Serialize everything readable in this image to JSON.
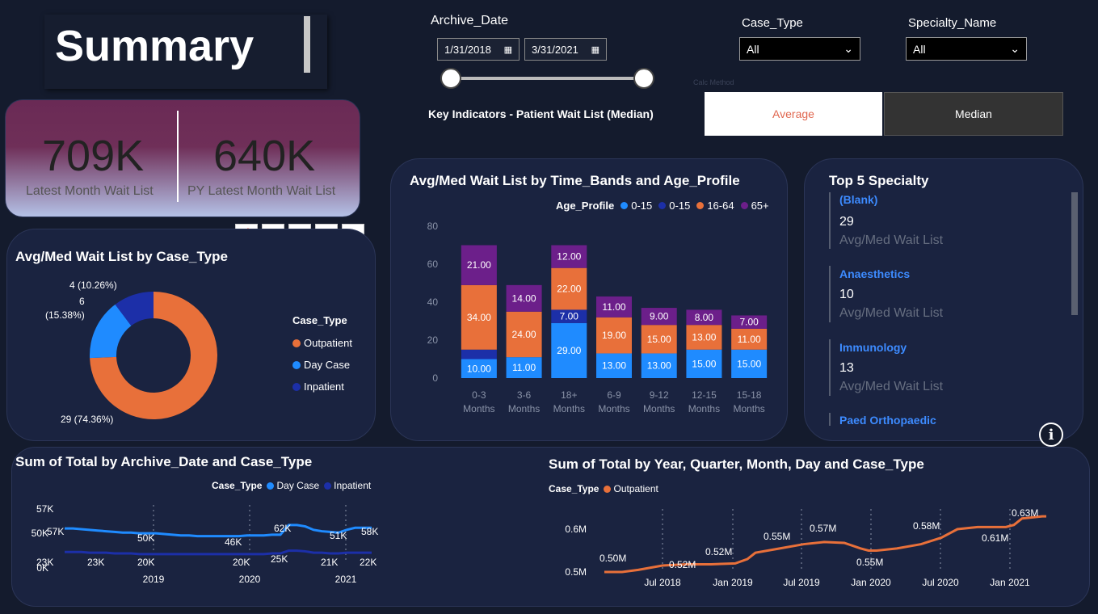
{
  "header": {
    "title": "Summary"
  },
  "archive_date": {
    "label": "Archive_Date",
    "start": "1/31/2018",
    "end": "3/31/2021"
  },
  "case_type": {
    "label": "Case_Type",
    "value": "All"
  },
  "specialty": {
    "label": "Specialty_Name",
    "value": "All"
  },
  "calc_method": {
    "label": "Calc Method",
    "average": "Average",
    "median": "Median"
  },
  "key_indicators": "Key Indicators - Patient Wait List (Median)",
  "kpi": {
    "latest_value": "709K",
    "latest_label": "Latest Month Wait List",
    "py_value": "640K",
    "py_label": "PY Latest Month Wait List"
  },
  "donut": {
    "title": "Avg/Med Wait List by Case_Type",
    "legend_title": "Case_Type",
    "labels": [
      "4 (10.26%)",
      "6",
      "(15.38%)",
      "29 (74.36%)"
    ],
    "legend": [
      {
        "name": "Outpatient",
        "color": "#e8703a"
      },
      {
        "name": "Day Case",
        "color": "#1f8bff"
      },
      {
        "name": "Inpatient",
        "color": "#1c2fa8"
      }
    ]
  },
  "bar": {
    "title": "Avg/Med Wait List by Time_Bands and Age_Profile",
    "legend_title": "Age_Profile",
    "legend": [
      {
        "name": "0-15",
        "color": "#1f8bff"
      },
      {
        "name": "0-15",
        "color": "#1c2fa8"
      },
      {
        "name": "16-64",
        "color": "#e8703a"
      },
      {
        "name": "65+",
        "color": "#6c1f8a"
      }
    ],
    "yticks": [
      "80",
      "60",
      "40",
      "20",
      "0"
    ],
    "cat_line1": [
      "0-3",
      "3-6",
      "18+",
      "6-9",
      "9-12",
      "12-15",
      "15-18"
    ],
    "cat_line2": [
      "Months",
      "Months",
      "Months",
      "Months",
      "Months",
      "Months",
      "Months"
    ]
  },
  "top5": {
    "title": "Top 5 Specialty",
    "items": [
      {
        "name": "(Blank)",
        "value": "29",
        "sub": "Avg/Med Wait List"
      },
      {
        "name": "Anaesthetics",
        "value": "10",
        "sub": "Avg/Med Wait List"
      },
      {
        "name": "Immunology",
        "value": "13",
        "sub": "Avg/Med Wait List"
      },
      {
        "name": "Paed Orthopaedic"
      }
    ]
  },
  "line1": {
    "title": "Sum of Total by Archive_Date and Case_Type",
    "legend_title": "Case_Type",
    "legend": [
      {
        "name": "Day Case",
        "color": "#1f8bff"
      },
      {
        "name": "Inpatient",
        "color": "#1c2fa8"
      }
    ],
    "yticks": [
      "50K",
      "0K"
    ],
    "xticks": [
      "2019",
      "2020",
      "2021"
    ],
    "labels_top": [
      "57K",
      "57K",
      "50K",
      "46K",
      "62K",
      "51K",
      "58K"
    ],
    "labels_bot": [
      "23K",
      "23K",
      "20K",
      "20K",
      "25K",
      "21K",
      "22K"
    ]
  },
  "line2": {
    "title": "Sum of Total by Year, Quarter, Month, Day and Case_Type",
    "legend_title": "Case_Type",
    "legend": [
      {
        "name": "Outpatient",
        "color": "#e8703a"
      }
    ],
    "yticks": [
      "0.6M",
      "0.5M"
    ],
    "xticks": [
      "Jul 2018",
      "Jan 2019",
      "Jul 2019",
      "Jan 2020",
      "Jul 2020",
      "Jan 2021"
    ],
    "labels": [
      "0.50M",
      "0.52M",
      "0.52M",
      "0.55M",
      "0.57M",
      "0.55M",
      "0.58M",
      "0.61M",
      "0.63M"
    ]
  },
  "chart_data": [
    {
      "type": "pie",
      "title": "Avg/Med Wait List by Case_Type",
      "categories": [
        "Outpatient",
        "Day Case",
        "Inpatient"
      ],
      "values": [
        29,
        6,
        4
      ]
    },
    {
      "type": "bar",
      "title": "Avg/Med Wait List by Time_Bands and Age_Profile",
      "categories": [
        "0-3 Months",
        "3-6 Months",
        "18+ Months",
        "6-9 Months",
        "9-12 Months",
        "12-15 Months",
        "15-18 Months"
      ],
      "series": [
        {
          "name": "0-15",
          "values": [
            10,
            11,
            29,
            13,
            13,
            15,
            15
          ]
        },
        {
          "name": "0-15",
          "values": [
            5,
            0,
            7,
            0,
            0,
            0,
            0
          ]
        },
        {
          "name": "16-64",
          "values": [
            34,
            24,
            22,
            19,
            15,
            13,
            11
          ]
        },
        {
          "name": "65+",
          "values": [
            21,
            14,
            12,
            11,
            9,
            8,
            7
          ]
        }
      ],
      "ylim": [
        0,
        80
      ]
    },
    {
      "type": "line",
      "title": "Sum of Total by Archive_Date and Case_Type",
      "series": [
        {
          "name": "Day Case",
          "values": [
            57,
            57,
            50,
            46,
            62,
            51,
            58
          ]
        },
        {
          "name": "Inpatient",
          "values": [
            23,
            23,
            20,
            20,
            25,
            21,
            22
          ]
        }
      ]
    },
    {
      "type": "line",
      "title": "Sum of Total by Year, Quarter, Month, Day and Case_Type",
      "series": [
        {
          "name": "Outpatient",
          "values": [
            0.5,
            0.52,
            0.52,
            0.55,
            0.57,
            0.55,
            0.58,
            0.61,
            0.63
          ]
        }
      ]
    }
  ]
}
